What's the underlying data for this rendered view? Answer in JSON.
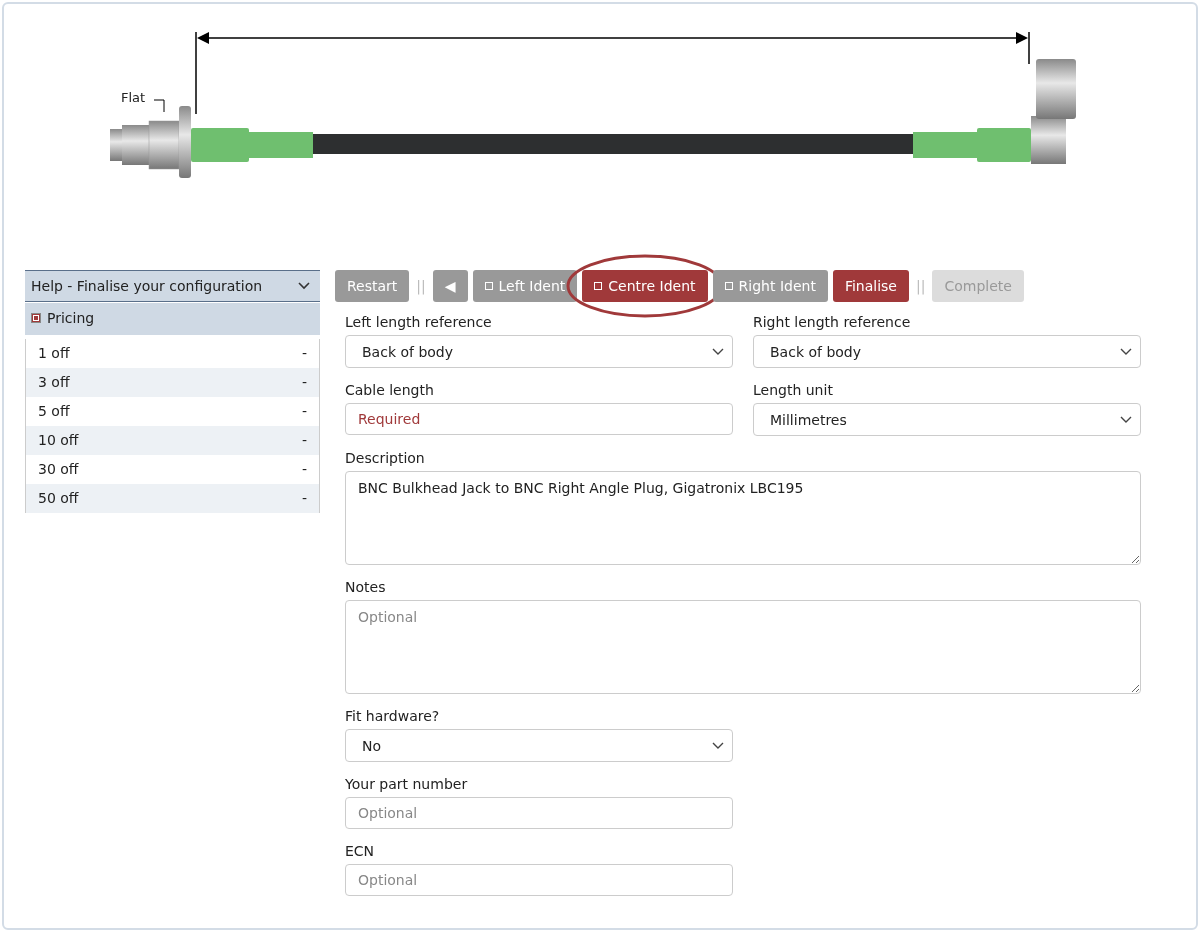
{
  "drawing": {
    "flat_label": "Flat"
  },
  "help_panel": {
    "title": "Help - Finalise your configuration",
    "expanded": true,
    "section": "Pricing",
    "pricing": [
      {
        "quantity": "1 off",
        "price": "-"
      },
      {
        "quantity": "3 off",
        "price": "-"
      },
      {
        "quantity": "5 off",
        "price": "-"
      },
      {
        "quantity": "10 off",
        "price": "-"
      },
      {
        "quantity": "30 off",
        "price": "-"
      },
      {
        "quantity": "50 off",
        "price": "-"
      }
    ]
  },
  "toolbar": [
    {
      "kind": "button",
      "label": "Restart",
      "selected": false,
      "disabled": false
    },
    {
      "kind": "separator",
      "label": "||"
    },
    {
      "kind": "button",
      "label": "◀",
      "selected": false,
      "disabled": false
    },
    {
      "kind": "ident",
      "label": "Left Ident",
      "selected": false,
      "disabled": false
    },
    {
      "kind": "ident",
      "label": "Centre Ident",
      "selected": true,
      "disabled": false,
      "circled": true
    },
    {
      "kind": "ident",
      "label": "Right Ident",
      "selected": false,
      "disabled": false
    },
    {
      "kind": "button",
      "label": "Finalise",
      "selected": true,
      "disabled": false
    },
    {
      "kind": "separator",
      "label": "||"
    },
    {
      "kind": "button",
      "label": "Complete",
      "selected": false,
      "disabled": true
    }
  ],
  "form": [
    [
      {
        "kind": "select",
        "label": "Left length reference",
        "value": "Back of body"
      },
      {
        "kind": "select",
        "label": "Right length reference",
        "value": "Back of body"
      }
    ],
    [
      {
        "kind": "input",
        "label": "Cable length",
        "placeholder": "Required",
        "required": true
      },
      {
        "kind": "select",
        "label": "Length unit",
        "value": "Millimetres"
      }
    ],
    [
      {
        "kind": "textarea",
        "label": "Description",
        "value": "BNC Bulkhead Jack to BNC Right Angle Plug, Gigatronix LBC195"
      }
    ],
    [
      {
        "kind": "textarea",
        "label": "Notes",
        "placeholder": "Optional"
      }
    ],
    [
      {
        "kind": "select",
        "label": "Fit hardware?",
        "value": "No"
      },
      {
        "kind": "blank"
      }
    ],
    [
      {
        "kind": "input",
        "label": "Your part number",
        "placeholder": "Optional",
        "required": false
      },
      {
        "kind": "blank"
      }
    ],
    [
      {
        "kind": "input",
        "label": "ECN",
        "placeholder": "Optional",
        "required": false
      },
      {
        "kind": "blank"
      }
    ]
  ]
}
